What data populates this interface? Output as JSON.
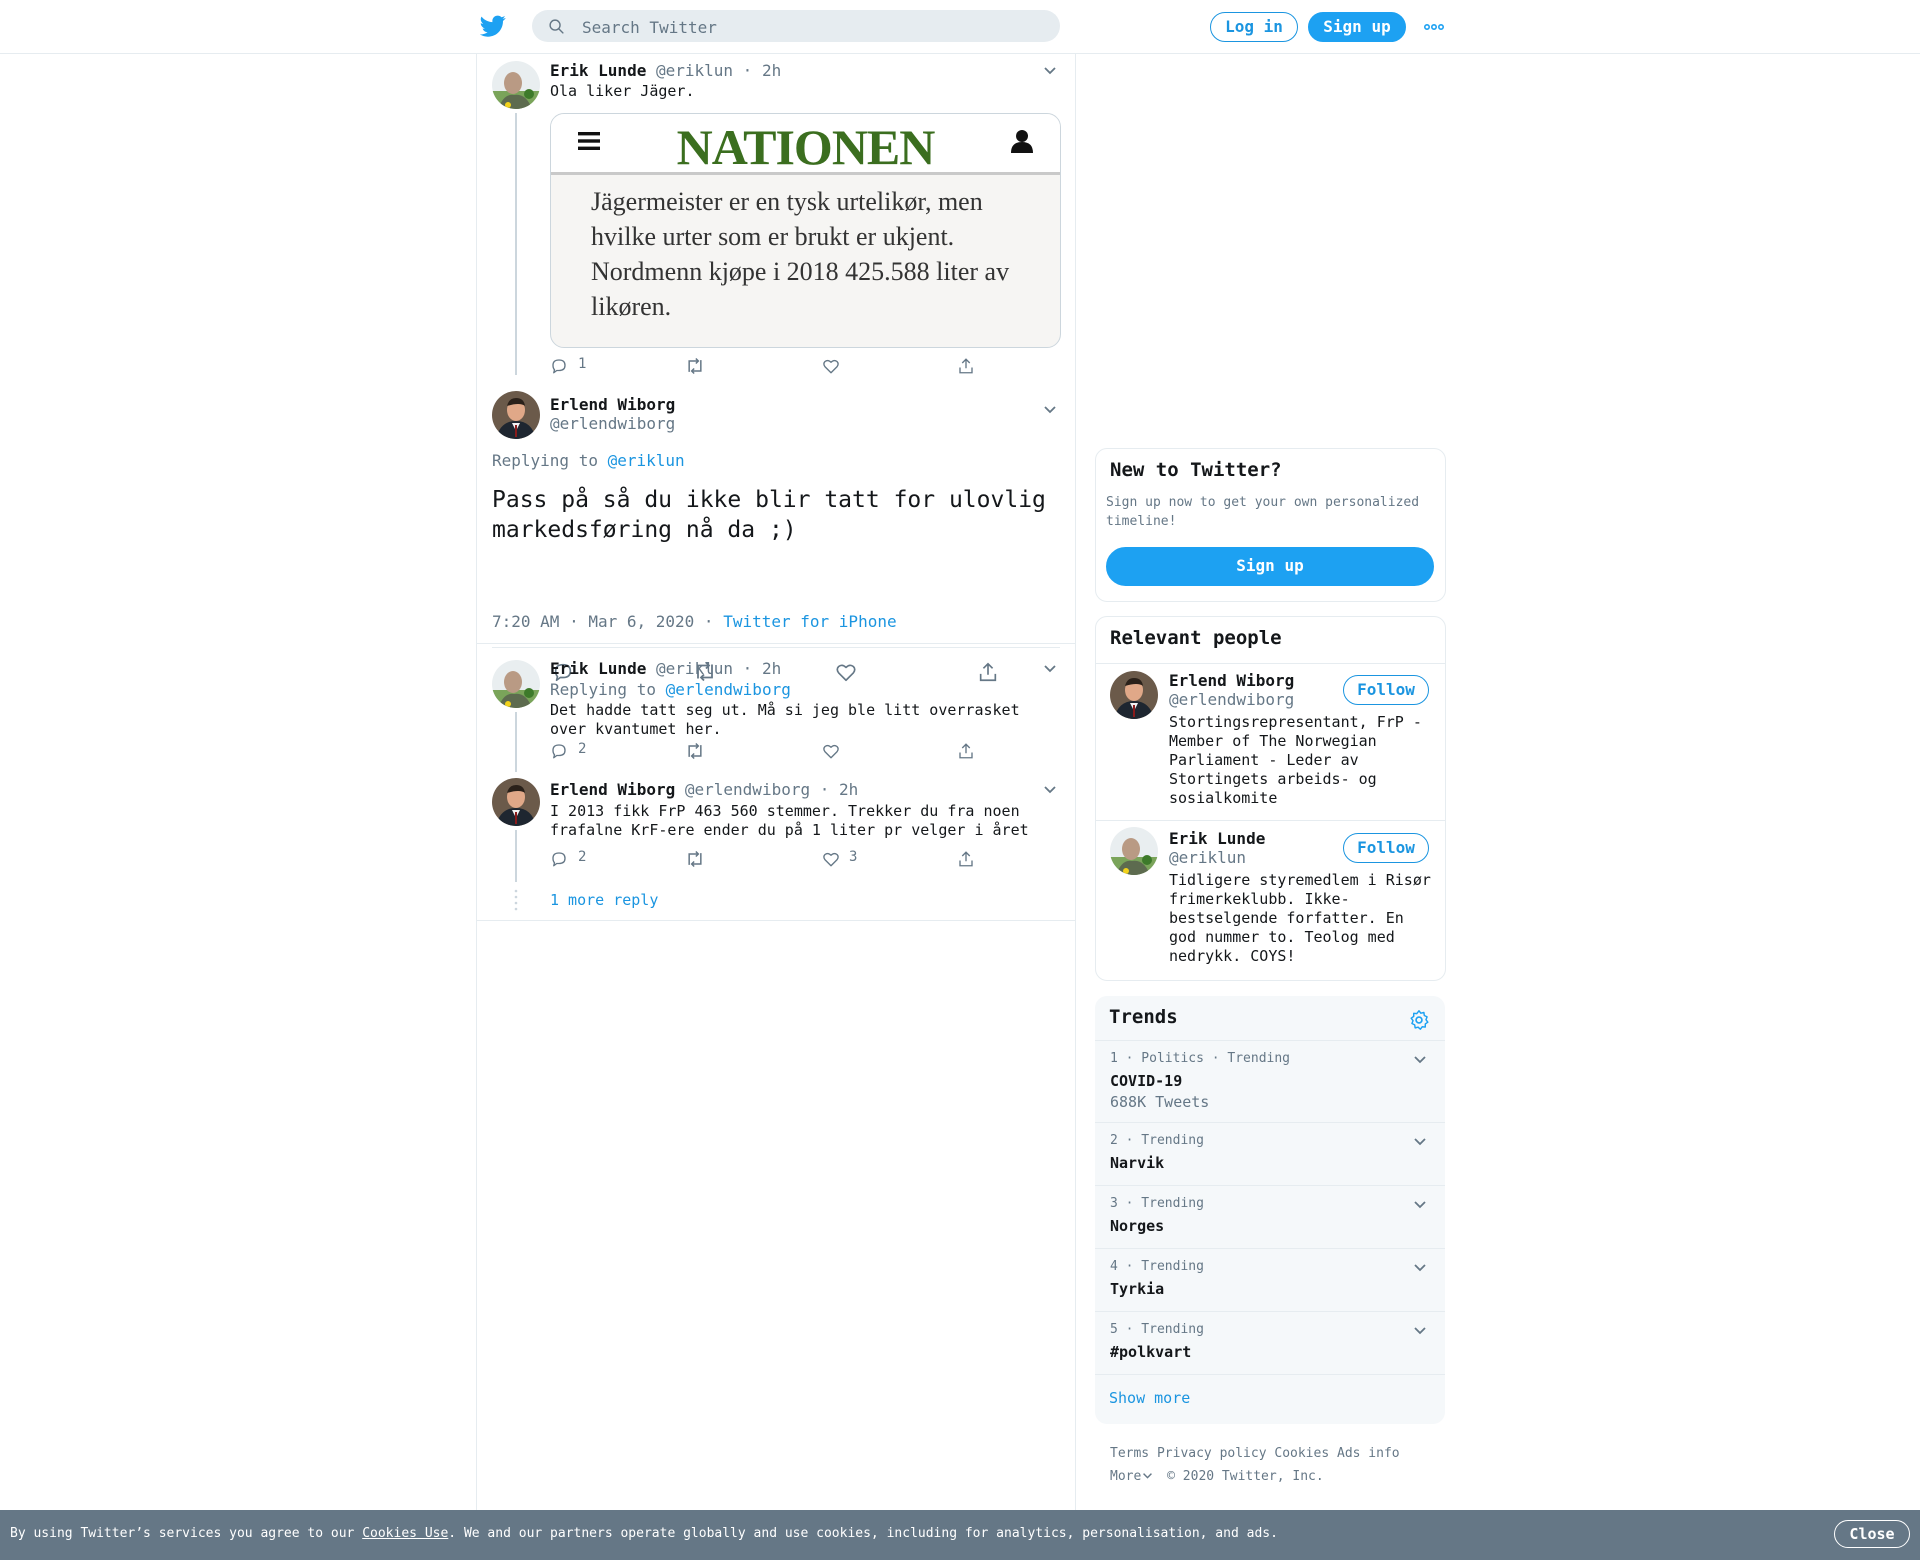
{
  "header": {
    "search_placeholder": "Search Twitter",
    "login_label": "Log in",
    "signup_label": "Sign up"
  },
  "thread": {
    "tweet1": {
      "name": "Erik Lunde",
      "handle": "@eriklun",
      "time": "· 2h",
      "text": "Ola liker Jäger.",
      "card": {
        "logo": "NATIONEN",
        "excerpt": "Jägermeister er en tysk urtelikør, men hvilke urter som er brukt er ukjent. Nordmenn kjøpe i 2018 425.588 liter av likøren."
      },
      "reply_count": "1"
    },
    "main": {
      "name": "Erlend Wiborg",
      "handle": "@erlendwiborg",
      "replying_prefix": "Replying to",
      "replying_handle": "@eriklun",
      "text": "Pass på så du ikke blir tatt for ulovlig markedsføring nå da ;)",
      "timestamp": "7:20 AM · Mar 6, 2020 ·",
      "source": "Twitter for iPhone"
    },
    "reply1": {
      "name": "Erik Lunde",
      "handle": "@eriklun",
      "time": "· 2h",
      "replying_prefix": "Replying to",
      "replying_handle": "@erlendwiborg",
      "text": "Det hadde tatt seg ut. Må si jeg ble litt overrasket over kvantumet her.",
      "reply_count": "2"
    },
    "reply2": {
      "name": "Erlend Wiborg",
      "handle": "@erlendwiborg",
      "time": "· 2h",
      "text": "I 2013 fikk FrP 463 560 stemmer. Trekker du fra noen frafalne KrF-ere ender du på 1 liter pr velger i året",
      "reply_count": "2",
      "like_count": "3"
    },
    "more_replies": "1 more reply"
  },
  "sidebar": {
    "new_to_twitter": {
      "title": "New to Twitter?",
      "desc": "Sign up now to get your own personalized timeline!",
      "button": "Sign up"
    },
    "relevant": {
      "title": "Relevant people",
      "people": [
        {
          "name": "Erlend Wiborg",
          "handle": "@erlendwiborg",
          "bio": "Stortingsrepresentant, FrP - Member of The Norwegian Parliament - Leder av Stortingets arbeids- og sosialkomite",
          "follow": "Follow"
        },
        {
          "name": "Erik Lunde",
          "handle": "@eriklun",
          "bio": "Tidligere styremedlem i Risør frimerkeklubb. Ikke-bestselgende forfatter. En god nummer to. Teolog med nedrykk. COYS!",
          "follow": "Follow"
        }
      ]
    },
    "trends": {
      "title": "Trends",
      "items": [
        {
          "meta": "1 · Politics · Trending",
          "name": "COVID-19",
          "count": "688K Tweets"
        },
        {
          "meta": "2 · Trending",
          "name": "Narvik"
        },
        {
          "meta": "3 · Trending",
          "name": "Norges"
        },
        {
          "meta": "4 · Trending",
          "name": "Tyrkia"
        },
        {
          "meta": "5 · Trending",
          "name": "#polkvart"
        }
      ],
      "show_more": "Show more"
    },
    "footer": {
      "links": [
        "Terms",
        "Privacy policy",
        "Cookies",
        "Ads info"
      ],
      "more": "More",
      "copyright": "© 2020 Twitter, Inc."
    }
  },
  "cookie": {
    "text_before": "By using Twitter’s services you agree to our",
    "link": "Cookies Use",
    "text_after": ". We and our partners operate globally and use cookies, including for analytics, personalisation, and ads.",
    "close": "Close"
  },
  "colors": {
    "accent": "#1da1f2",
    "link": "#1b95e0",
    "muted": "#657786",
    "cookie_bg": "#657786",
    "trends_bg": "#f5f8fa"
  }
}
